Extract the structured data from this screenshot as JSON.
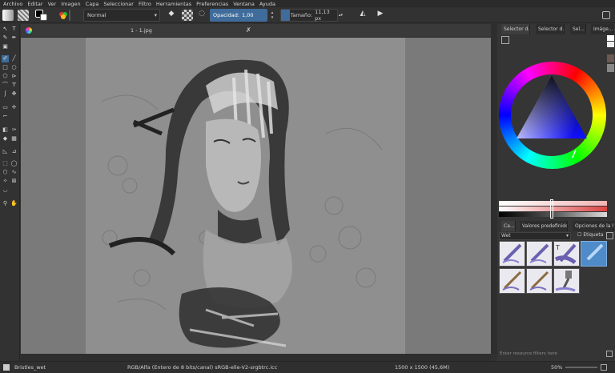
{
  "menu": [
    "Archivo",
    "Editar",
    "Ver",
    "Imagen",
    "Capa",
    "Seleccionar",
    "Filtro",
    "Herramientas",
    "Preferencias",
    "Ventana",
    "Ayuda"
  ],
  "toolbar": {
    "blend_mode": "Normal",
    "opacity_label": "Opacidad:",
    "opacity_value": "1,00",
    "size_label": "Tamaño:",
    "size_value": "11,13 px"
  },
  "document": {
    "tab_title": "1 - 1.jpg"
  },
  "dock": {
    "tabs_top": [
      "Selector d...",
      "Selector d...",
      "Sel...",
      "Imáge..."
    ],
    "tabs_bottom": [
      "Ca...",
      "Valores predefinido...",
      "Opciones de la h..."
    ],
    "filter_value": "Wet",
    "tag_label": "Etiqueta",
    "search_placeholder": "Enter resource filters here"
  },
  "status": {
    "brush": "Bristles_wet",
    "color_model": "RGB/Alfa (Entero de 8 bits/canal)  sRGB-elle-V2-srgbtrc.icc",
    "dimensions": "1500 x 1500 (45,6M)",
    "zoom": "50%"
  },
  "colors": {
    "accent": "#3f6c9a",
    "canvas": "#8f8f8f",
    "bg": "#313131"
  }
}
